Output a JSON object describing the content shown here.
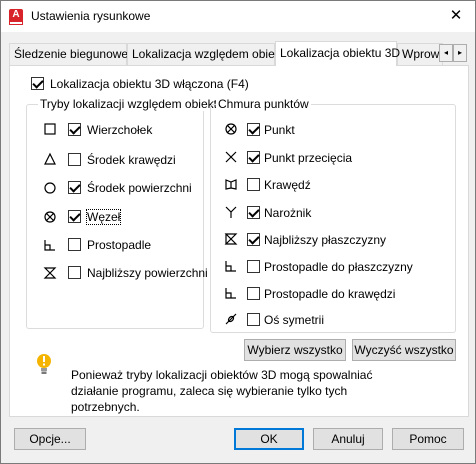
{
  "window": {
    "title": "Ustawienia rysunkowe",
    "close_glyph": "✕"
  },
  "tabs": [
    {
      "label": "Śledzenie biegunowe",
      "active": false
    },
    {
      "label": "Lokalizacja względem obiektu",
      "active": false
    },
    {
      "label": "Lokalizacja obiektu 3D",
      "active": true
    },
    {
      "label": "Wprow",
      "active": false
    }
  ],
  "tab_scroll": {
    "left": "◂",
    "right": "▸"
  },
  "enable_checkbox": {
    "label": "Lokalizacja obiektu 3D włączona (F4)",
    "checked": true
  },
  "object_snap_group": {
    "title": "Tryby lokalizacji względem obiektu",
    "items": [
      {
        "label": "Wierzchołek",
        "checked": true,
        "icon": "square-icon"
      },
      {
        "label": "Środek krawędzi",
        "checked": false,
        "icon": "triangle-icon"
      },
      {
        "label": "Środek powierzchni",
        "checked": true,
        "icon": "circle-icon"
      },
      {
        "label": "Węzeł",
        "checked": true,
        "icon": "node-icon"
      },
      {
        "label": "Prostopadle",
        "checked": false,
        "icon": "perpendicular-icon"
      },
      {
        "label": "Najbliższy powierzchni",
        "checked": false,
        "icon": "hourglass-icon"
      }
    ]
  },
  "point_cloud_group": {
    "title": "Chmura punktów",
    "items": [
      {
        "label": "Punkt",
        "checked": true,
        "icon": "node-icon"
      },
      {
        "label": "Punkt przecięcia",
        "checked": true,
        "icon": "cross-icon"
      },
      {
        "label": "Krawędź",
        "checked": false,
        "icon": "edge-icon"
      },
      {
        "label": "Narożnik",
        "checked": true,
        "icon": "y-corner-icon"
      },
      {
        "label": "Najbliższy płaszczyzny",
        "checked": true,
        "icon": "hourglass-icon"
      },
      {
        "label": "Prostopadle do płaszczyzny",
        "checked": false,
        "icon": "perpendicular-icon"
      },
      {
        "label": "Prostopadle do krawędzi",
        "checked": false,
        "icon": "perpendicular-icon"
      },
      {
        "label": "Oś symetrii",
        "checked": false,
        "icon": "axis-icon"
      }
    ]
  },
  "buttons": {
    "select_all": "Wybierz wszystko",
    "clear_all": "Wyczyść wszystko"
  },
  "info": {
    "text": "Ponieważ tryby lokalizacji obiektów 3D mogą spowalniać działanie programu, zaleca się wybieranie tylko tych potrzebnych."
  },
  "footer": {
    "options": "Opcje...",
    "ok": "OK",
    "cancel": "Anuluj",
    "help": "Pomoc"
  },
  "colors": {
    "accent": "#0078d7",
    "brand": "#d8232a",
    "info_bulb": "#f4b400"
  }
}
